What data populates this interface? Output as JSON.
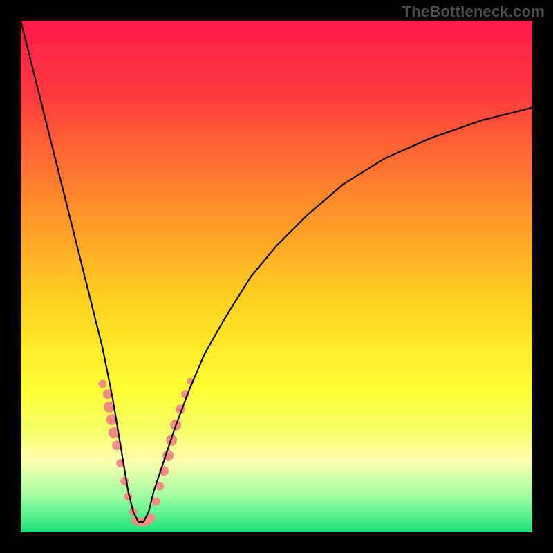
{
  "watermark": "TheBottleneck.com",
  "chart_data": {
    "type": "line",
    "title": "",
    "xlabel": "",
    "ylabel": "",
    "xlim": [
      0,
      100
    ],
    "ylim": [
      0,
      100
    ],
    "grid": false,
    "legend": false,
    "gradient_stops": [
      {
        "offset": 0.0,
        "color": "#ff1a4b"
      },
      {
        "offset": 0.15,
        "color": "#ff3c3c"
      },
      {
        "offset": 0.35,
        "color": "#ff8a2a"
      },
      {
        "offset": 0.55,
        "color": "#ffd21f"
      },
      {
        "offset": 0.72,
        "color": "#ffff33"
      },
      {
        "offset": 0.8,
        "color": "#f3ff66"
      },
      {
        "offset": 0.86,
        "color": "#ffffb0"
      },
      {
        "offset": 0.93,
        "color": "#9fff9f"
      },
      {
        "offset": 1.0,
        "color": "#19e07a"
      }
    ],
    "series": [
      {
        "name": "curve",
        "color": "#000000",
        "x": [
          0,
          2,
          4,
          6,
          8,
          10,
          12,
          14,
          16,
          18,
          19,
          20,
          21,
          22,
          23,
          24,
          25,
          26,
          28,
          30,
          33,
          36,
          40,
          45,
          50,
          56,
          63,
          71,
          80,
          90,
          100
        ],
        "y": [
          100,
          92,
          84,
          76,
          68,
          60,
          52,
          44,
          36,
          26,
          20,
          14,
          8,
          4,
          2,
          2,
          4,
          8,
          14,
          20,
          28,
          35,
          42,
          50,
          56,
          62,
          68,
          73,
          77,
          80.5,
          83
        ]
      }
    ],
    "scatter_clusters": [
      {
        "name": "left-cluster",
        "color": "#f28b82",
        "points": [
          {
            "x": 16.0,
            "y": 29.0,
            "r": 6
          },
          {
            "x": 17.0,
            "y": 27.0,
            "r": 7
          },
          {
            "x": 17.3,
            "y": 24.5,
            "r": 8
          },
          {
            "x": 17.8,
            "y": 22.0,
            "r": 8
          },
          {
            "x": 18.2,
            "y": 19.5,
            "r": 8
          },
          {
            "x": 18.8,
            "y": 17.0,
            "r": 7
          },
          {
            "x": 19.5,
            "y": 13.5,
            "r": 6
          },
          {
            "x": 20.3,
            "y": 10.0,
            "r": 6
          },
          {
            "x": 21.0,
            "y": 7.0,
            "r": 6
          },
          {
            "x": 22.0,
            "y": 4.0,
            "r": 6
          }
        ]
      },
      {
        "name": "bottom-cluster",
        "color": "#f28b82",
        "points": [
          {
            "x": 22.5,
            "y": 2.3,
            "r": 6
          },
          {
            "x": 23.3,
            "y": 2.0,
            "r": 6
          },
          {
            "x": 24.0,
            "y": 2.0,
            "r": 6
          },
          {
            "x": 24.8,
            "y": 2.2,
            "r": 6
          },
          {
            "x": 25.5,
            "y": 2.8,
            "r": 6
          }
        ]
      },
      {
        "name": "right-cluster",
        "color": "#f28b82",
        "points": [
          {
            "x": 26.5,
            "y": 6.0,
            "r": 6
          },
          {
            "x": 27.2,
            "y": 9.0,
            "r": 6
          },
          {
            "x": 28.0,
            "y": 12.0,
            "r": 7
          },
          {
            "x": 28.8,
            "y": 15.0,
            "r": 8
          },
          {
            "x": 29.5,
            "y": 18.0,
            "r": 8
          },
          {
            "x": 30.3,
            "y": 21.0,
            "r": 8
          },
          {
            "x": 31.2,
            "y": 24.0,
            "r": 7
          },
          {
            "x": 32.2,
            "y": 27.0,
            "r": 6
          },
          {
            "x": 33.2,
            "y": 29.5,
            "r": 5
          }
        ]
      }
    ]
  }
}
